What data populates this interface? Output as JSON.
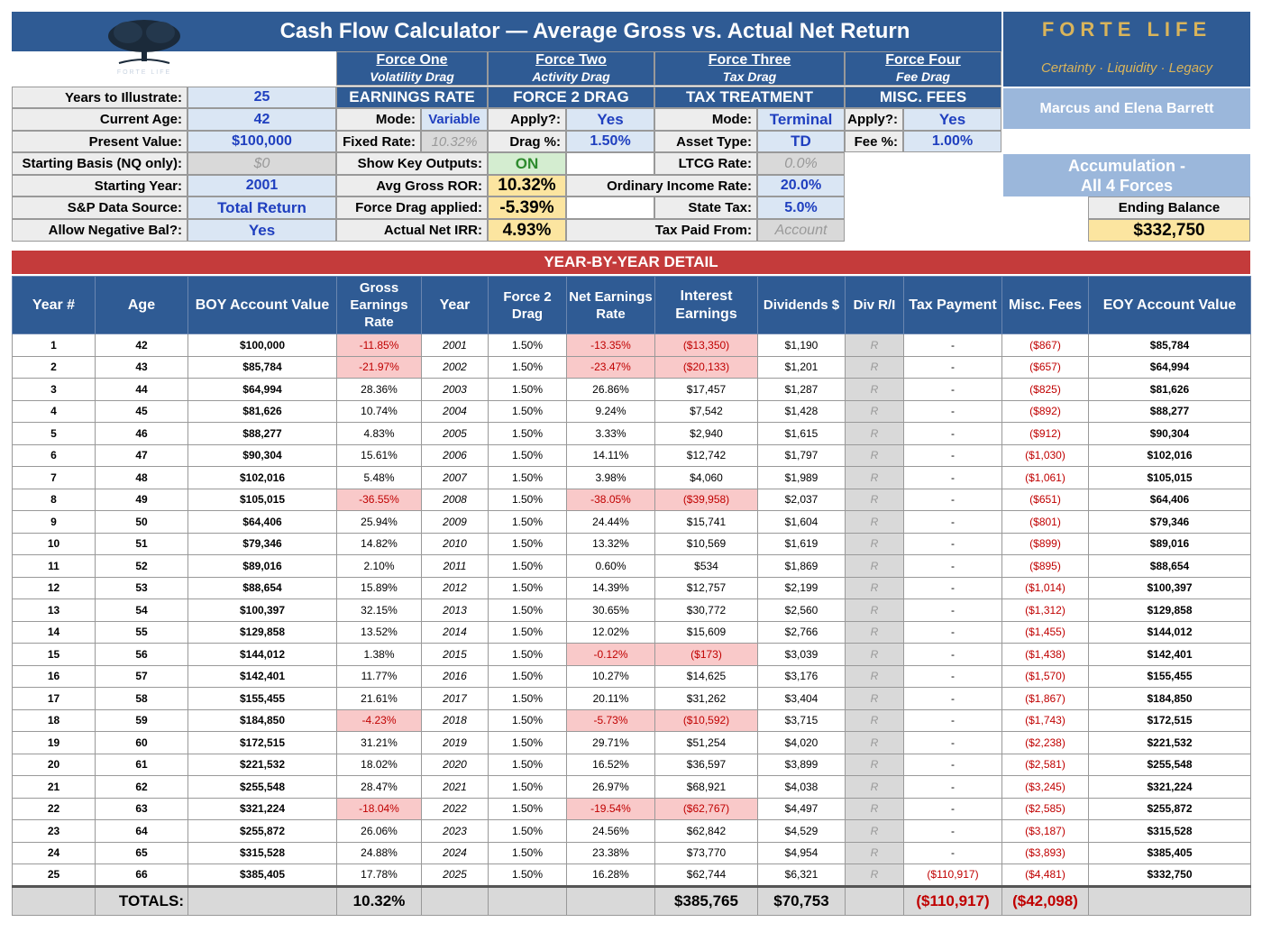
{
  "header": {
    "title": "Cash Flow Calculator — Average Gross vs. Actual Net Return",
    "brand": "FORTE LIFE",
    "tagline": "Certainty · Liquidity · Legacy",
    "client": "Marcus and Elena Barrett",
    "logo_text": "FORTE LIFE"
  },
  "forces": [
    {
      "title": "Force One",
      "subtitle": "Volatility Drag",
      "section": "EARNINGS RATE"
    },
    {
      "title": "Force Two",
      "subtitle": "Activity Drag",
      "section": "FORCE 2 DRAG"
    },
    {
      "title": "Force Three",
      "subtitle": "Tax Drag",
      "section": "TAX TREATMENT"
    },
    {
      "title": "Force Four",
      "subtitle": "Fee Drag",
      "section": "MISC. FEES"
    }
  ],
  "inputs": {
    "years_label": "Years to Illustrate:",
    "years": "25",
    "age_label": "Current Age:",
    "age": "42",
    "pv_label": "Present Value:",
    "pv": "$100,000",
    "basis_label": "Starting Basis (NQ only):",
    "basis": "$0",
    "start_year_label": "Starting Year:",
    "start_year": "2001",
    "source_label": "S&P Data Source:",
    "source": "Total Return",
    "neg_label": "Allow Negative Bal?:",
    "neg": "Yes"
  },
  "f1": {
    "mode_label": "Mode:",
    "mode": "Variable",
    "fixed_label": "Fixed Rate:",
    "fixed": "10.32%",
    "show_label": "Show Key Outputs:",
    "show": "ON",
    "avg_label": "Avg Gross ROR:",
    "avg": "10.32%",
    "drag_label": "Force Drag applied:",
    "drag": "-5.39%",
    "irr_label": "Actual Net IRR:",
    "irr": "4.93%"
  },
  "f2": {
    "apply_label": "Apply?:",
    "apply": "Yes",
    "drag_label": "Drag %:",
    "drag": "1.50%"
  },
  "f3": {
    "mode_label": "Mode:",
    "mode": "Terminal",
    "asset_label": "Asset Type:",
    "asset": "TD",
    "ltcg_label": "LTCG Rate:",
    "ltcg": "0.0%",
    "ord_label": "Ordinary Income Rate:",
    "ord": "20.0%",
    "state_label": "State Tax:",
    "state": "5.0%",
    "paid_label": "Tax Paid From:",
    "paid": "Account"
  },
  "f4": {
    "apply_label": "Apply?:",
    "apply": "Yes",
    "fee_label": "Fee %:",
    "fee": "1.00%"
  },
  "summary": {
    "accum_line1": "Accumulation -",
    "accum_line2": "All 4 Forces",
    "ending_label": "Ending Balance",
    "ending": "$332,750"
  },
  "table": {
    "banner": "YEAR-BY-YEAR DETAIL",
    "headers": [
      "Year #",
      "Age",
      "BOY Account Value",
      "Gross Earnings Rate",
      "Year",
      "Force 2 Drag",
      "Net Earnings Rate",
      "Interest Earnings",
      "Dividends $",
      "Div R/I",
      "Tax Payment",
      "Misc. Fees",
      "EOY Account Value"
    ],
    "rows": [
      [
        "1",
        "42",
        "$100,000",
        "-11.85%",
        "2001",
        "1.50%",
        "-13.35%",
        "($13,350)",
        "$1,190",
        "R",
        "-",
        "($867)",
        "$85,784"
      ],
      [
        "2",
        "43",
        "$85,784",
        "-21.97%",
        "2002",
        "1.50%",
        "-23.47%",
        "($20,133)",
        "$1,201",
        "R",
        "-",
        "($657)",
        "$64,994"
      ],
      [
        "3",
        "44",
        "$64,994",
        "28.36%",
        "2003",
        "1.50%",
        "26.86%",
        "$17,457",
        "$1,287",
        "R",
        "-",
        "($825)",
        "$81,626"
      ],
      [
        "4",
        "45",
        "$81,626",
        "10.74%",
        "2004",
        "1.50%",
        "9.24%",
        "$7,542",
        "$1,428",
        "R",
        "-",
        "($892)",
        "$88,277"
      ],
      [
        "5",
        "46",
        "$88,277",
        "4.83%",
        "2005",
        "1.50%",
        "3.33%",
        "$2,940",
        "$1,615",
        "R",
        "-",
        "($912)",
        "$90,304"
      ],
      [
        "6",
        "47",
        "$90,304",
        "15.61%",
        "2006",
        "1.50%",
        "14.11%",
        "$12,742",
        "$1,797",
        "R",
        "-",
        "($1,030)",
        "$102,016"
      ],
      [
        "7",
        "48",
        "$102,016",
        "5.48%",
        "2007",
        "1.50%",
        "3.98%",
        "$4,060",
        "$1,989",
        "R",
        "-",
        "($1,061)",
        "$105,015"
      ],
      [
        "8",
        "49",
        "$105,015",
        "-36.55%",
        "2008",
        "1.50%",
        "-38.05%",
        "($39,958)",
        "$2,037",
        "R",
        "-",
        "($651)",
        "$64,406"
      ],
      [
        "9",
        "50",
        "$64,406",
        "25.94%",
        "2009",
        "1.50%",
        "24.44%",
        "$15,741",
        "$1,604",
        "R",
        "-",
        "($801)",
        "$79,346"
      ],
      [
        "10",
        "51",
        "$79,346",
        "14.82%",
        "2010",
        "1.50%",
        "13.32%",
        "$10,569",
        "$1,619",
        "R",
        "-",
        "($899)",
        "$89,016"
      ],
      [
        "11",
        "52",
        "$89,016",
        "2.10%",
        "2011",
        "1.50%",
        "0.60%",
        "$534",
        "$1,869",
        "R",
        "-",
        "($895)",
        "$88,654"
      ],
      [
        "12",
        "53",
        "$88,654",
        "15.89%",
        "2012",
        "1.50%",
        "14.39%",
        "$12,757",
        "$2,199",
        "R",
        "-",
        "($1,014)",
        "$100,397"
      ],
      [
        "13",
        "54",
        "$100,397",
        "32.15%",
        "2013",
        "1.50%",
        "30.65%",
        "$30,772",
        "$2,560",
        "R",
        "-",
        "($1,312)",
        "$129,858"
      ],
      [
        "14",
        "55",
        "$129,858",
        "13.52%",
        "2014",
        "1.50%",
        "12.02%",
        "$15,609",
        "$2,766",
        "R",
        "-",
        "($1,455)",
        "$144,012"
      ],
      [
        "15",
        "56",
        "$144,012",
        "1.38%",
        "2015",
        "1.50%",
        "-0.12%",
        "($173)",
        "$3,039",
        "R",
        "-",
        "($1,438)",
        "$142,401"
      ],
      [
        "16",
        "57",
        "$142,401",
        "11.77%",
        "2016",
        "1.50%",
        "10.27%",
        "$14,625",
        "$3,176",
        "R",
        "-",
        "($1,570)",
        "$155,455"
      ],
      [
        "17",
        "58",
        "$155,455",
        "21.61%",
        "2017",
        "1.50%",
        "20.11%",
        "$31,262",
        "$3,404",
        "R",
        "-",
        "($1,867)",
        "$184,850"
      ],
      [
        "18",
        "59",
        "$184,850",
        "-4.23%",
        "2018",
        "1.50%",
        "-5.73%",
        "($10,592)",
        "$3,715",
        "R",
        "-",
        "($1,743)",
        "$172,515"
      ],
      [
        "19",
        "60",
        "$172,515",
        "31.21%",
        "2019",
        "1.50%",
        "29.71%",
        "$51,254",
        "$4,020",
        "R",
        "-",
        "($2,238)",
        "$221,532"
      ],
      [
        "20",
        "61",
        "$221,532",
        "18.02%",
        "2020",
        "1.50%",
        "16.52%",
        "$36,597",
        "$3,899",
        "R",
        "-",
        "($2,581)",
        "$255,548"
      ],
      [
        "21",
        "62",
        "$255,548",
        "28.47%",
        "2021",
        "1.50%",
        "26.97%",
        "$68,921",
        "$4,038",
        "R",
        "-",
        "($3,245)",
        "$321,224"
      ],
      [
        "22",
        "63",
        "$321,224",
        "-18.04%",
        "2022",
        "1.50%",
        "-19.54%",
        "($62,767)",
        "$4,497",
        "R",
        "-",
        "($2,585)",
        "$255,872"
      ],
      [
        "23",
        "64",
        "$255,872",
        "26.06%",
        "2023",
        "1.50%",
        "24.56%",
        "$62,842",
        "$4,529",
        "R",
        "-",
        "($3,187)",
        "$315,528"
      ],
      [
        "24",
        "65",
        "$315,528",
        "24.88%",
        "2024",
        "1.50%",
        "23.38%",
        "$73,770",
        "$4,954",
        "R",
        "-",
        "($3,893)",
        "$385,405"
      ],
      [
        "25",
        "66",
        "$385,405",
        "17.78%",
        "2025",
        "1.50%",
        "16.28%",
        "$62,744",
        "$6,321",
        "R",
        "($110,917)",
        "($4,481)",
        "$332,750"
      ]
    ],
    "totals": {
      "label": "TOTALS:",
      "gross": "10.32%",
      "interest": "$385,765",
      "dividends": "$70,753",
      "tax": "($110,917)",
      "fees": "($42,098)"
    }
  }
}
